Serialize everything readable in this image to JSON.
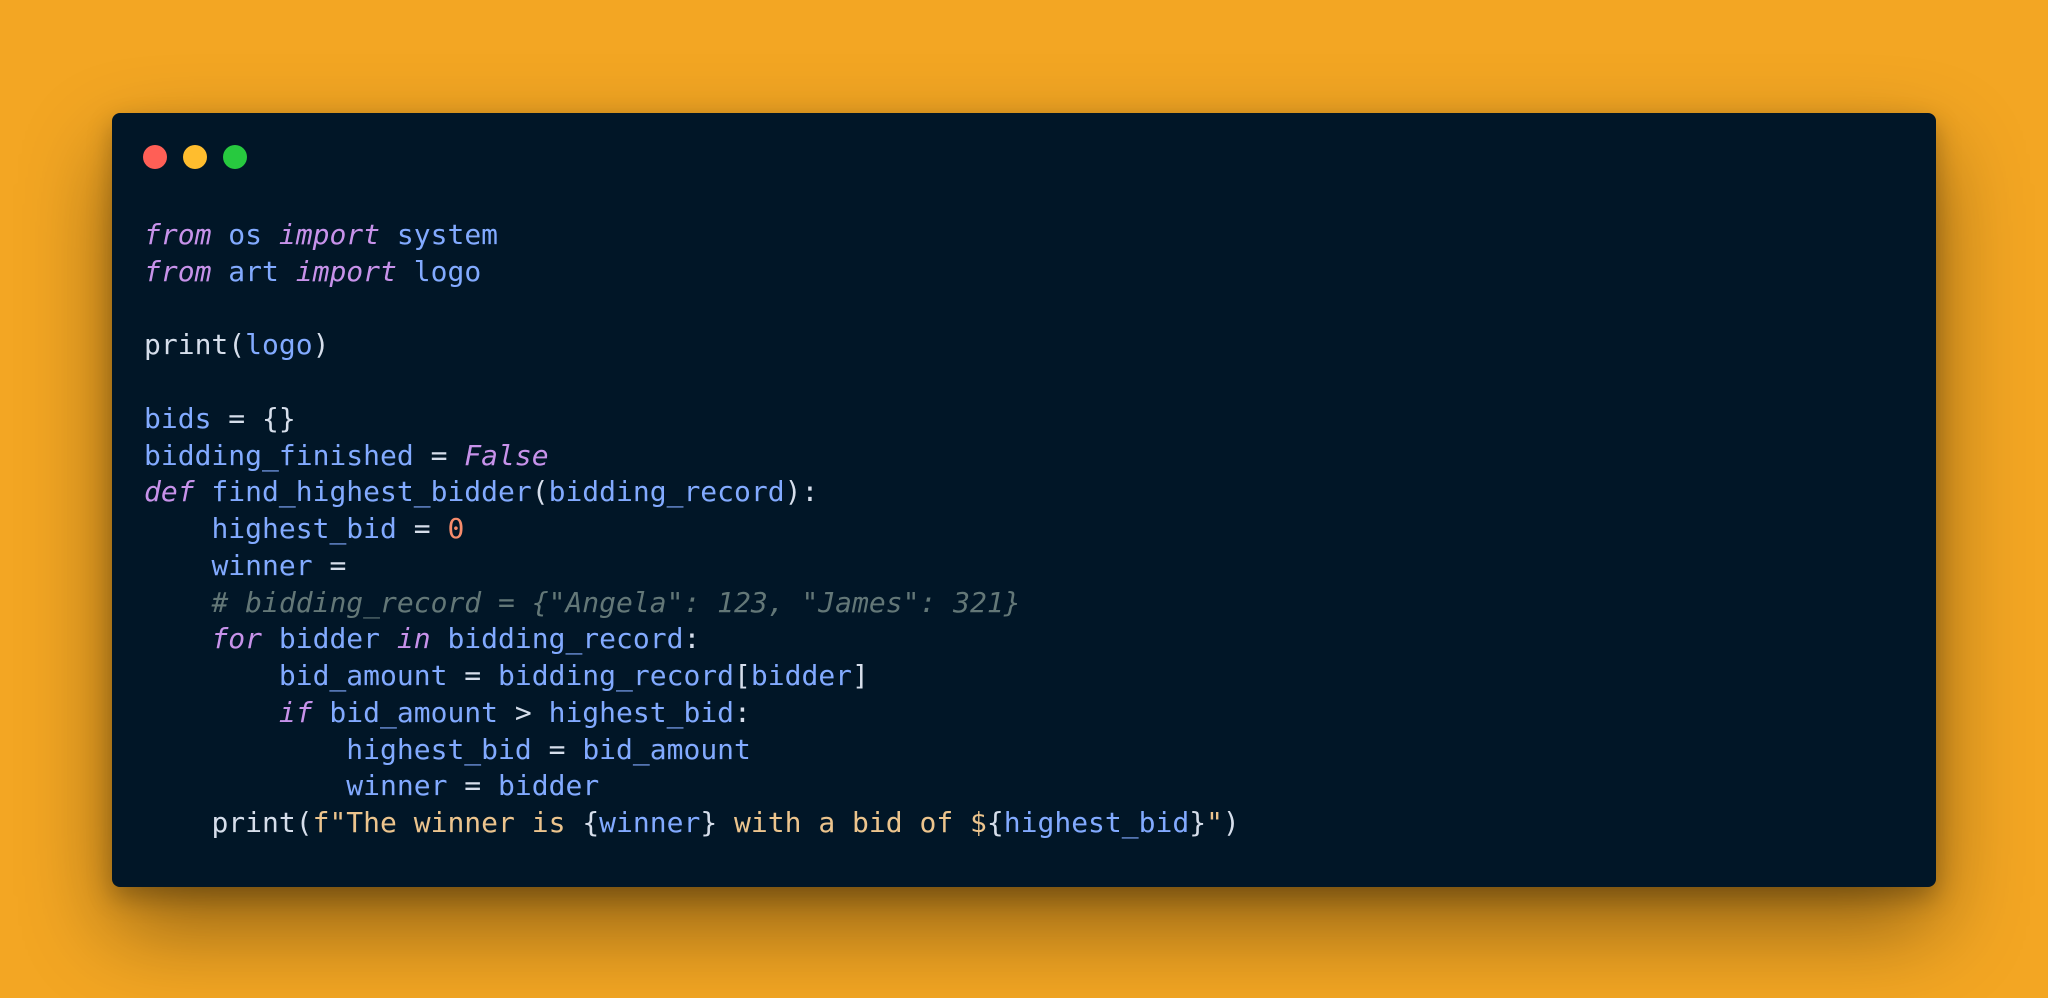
{
  "colors": {
    "background": "#f3a623",
    "window": "#011627",
    "close": "#ff5f56",
    "minimize": "#ffbd2e",
    "maximize": "#27c93f",
    "keyword": "#c792ea",
    "variable": "#82aaff",
    "text": "#d6deeb",
    "number": "#f78c6c",
    "string": "#ecc48d",
    "comment": "#637777"
  },
  "code": {
    "l1": {
      "a": "from",
      "b": " os ",
      "c": "import",
      "d": " system"
    },
    "l2": {
      "a": "from",
      "b": " art ",
      "c": "import",
      "d": " logo"
    },
    "l4": {
      "a": "print(",
      "b": "logo",
      "c": ")"
    },
    "l6": {
      "a": "bids",
      "b": " = {}"
    },
    "l7": {
      "a": "bidding_finished",
      "b": " = ",
      "c": "False"
    },
    "l8": {
      "a": "def",
      "b": " find_highest_bidder",
      "c": "(",
      "d": "bidding_record",
      "e": "):"
    },
    "l9": {
      "a": "    ",
      "b": "highest_bid",
      "c": " = ",
      "d": "0"
    },
    "l10": {
      "a": "    ",
      "b": "winner",
      "c": " ="
    },
    "l11": {
      "a": "    ",
      "b": "# bidding_record = {\"Angela\": 123, \"James\": 321}"
    },
    "l12": {
      "a": "    ",
      "b": "for",
      "c": " bidder ",
      "d": "in",
      "e": " bidding_record",
      "f": ":"
    },
    "l13": {
      "a": "        ",
      "b": "bid_amount",
      "c": " = ",
      "d": "bidding_record",
      "e": "[",
      "f": "bidder",
      "g": "]"
    },
    "l14": {
      "a": "        ",
      "b": "if",
      "c": " bid_amount ",
      "d": ">",
      "e": " highest_bid",
      "f": ":"
    },
    "l15": {
      "a": "            ",
      "b": "highest_bid",
      "c": " = ",
      "d": "bid_amount"
    },
    "l16": {
      "a": "            ",
      "b": "winner",
      "c": " = ",
      "d": "bidder"
    },
    "l17": {
      "a": "    ",
      "b": "print(",
      "c": "f\"The winner is ",
      "d": "{",
      "e": "winner",
      "f": "}",
      "g": " with a bid of $",
      "h": "{",
      "i": "highest_bid",
      "j": "}",
      "k": "\"",
      "l": ")"
    }
  }
}
